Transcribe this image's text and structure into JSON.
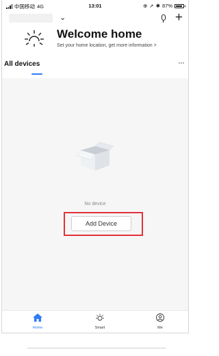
{
  "status_bar": {
    "carrier": "中国移动",
    "network": "4G",
    "time": "13:01",
    "battery": "87%"
  },
  "header": {
    "chevron_icon": "chevron-down-icon",
    "mic_icon": "microphone-icon",
    "add_icon": "plus-icon"
  },
  "welcome": {
    "title": "Welcome home",
    "subtitle": "Set your home location, get more information",
    "arrow": ">"
  },
  "tabs": {
    "all_devices": "All devices",
    "more": "···"
  },
  "empty_state": {
    "message": "No device",
    "add_button": "Add Device"
  },
  "bottom_nav": {
    "items": [
      {
        "label": "Home",
        "icon": "home-icon",
        "active": true
      },
      {
        "label": "Smart",
        "icon": "sun-icon",
        "active": false
      },
      {
        "label": "Me",
        "icon": "user-icon",
        "active": false
      }
    ]
  },
  "colors": {
    "accent": "#2f7cf6",
    "highlight_border": "#e0313a"
  }
}
